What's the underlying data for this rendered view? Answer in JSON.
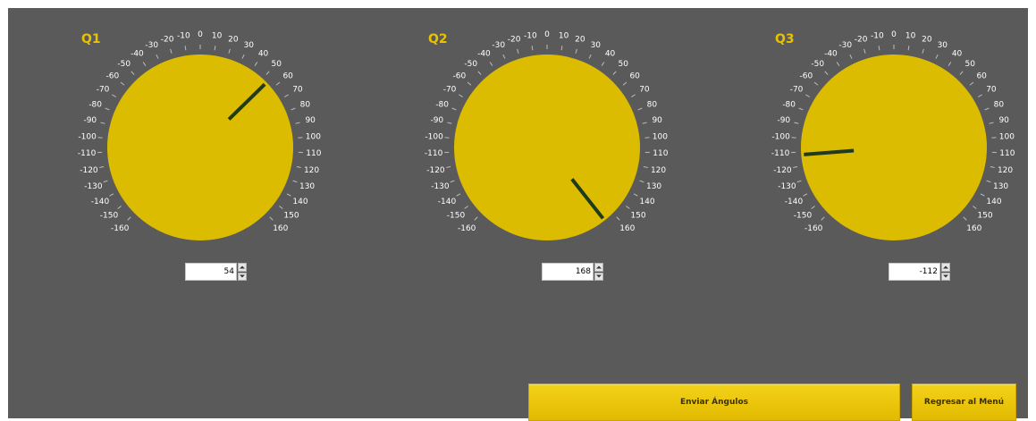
{
  "colors": {
    "panel_background": "#5a5a5a",
    "dial_face": "#dcbc00",
    "title_accent": "#e8c100",
    "needle": "#1f3a1f",
    "tick_label": "#ffffff",
    "button_fill": "#e8c300"
  },
  "scale": {
    "min": -160,
    "max": 160,
    "labels": [
      "-160",
      "-150",
      "-140",
      "-130",
      "-120",
      "-110",
      "-100",
      "-90",
      "-80",
      "-70",
      "-60",
      "-50",
      "-40",
      "-30",
      "-20",
      "-10",
      "0",
      "10",
      "20",
      "30",
      "40",
      "50",
      "60",
      "70",
      "80",
      "90",
      "100",
      "110",
      "120",
      "130",
      "140",
      "150",
      "160"
    ]
  },
  "knobs": [
    {
      "title": "Q1",
      "value": 54,
      "display_value": "54"
    },
    {
      "title": "Q2",
      "value": 168,
      "display_value": "168"
    },
    {
      "title": "Q3",
      "value": -112,
      "display_value": "-112"
    }
  ],
  "buttons": {
    "send_label": "Enviar Ángulos",
    "back_label": "Regresar al Menú"
  }
}
